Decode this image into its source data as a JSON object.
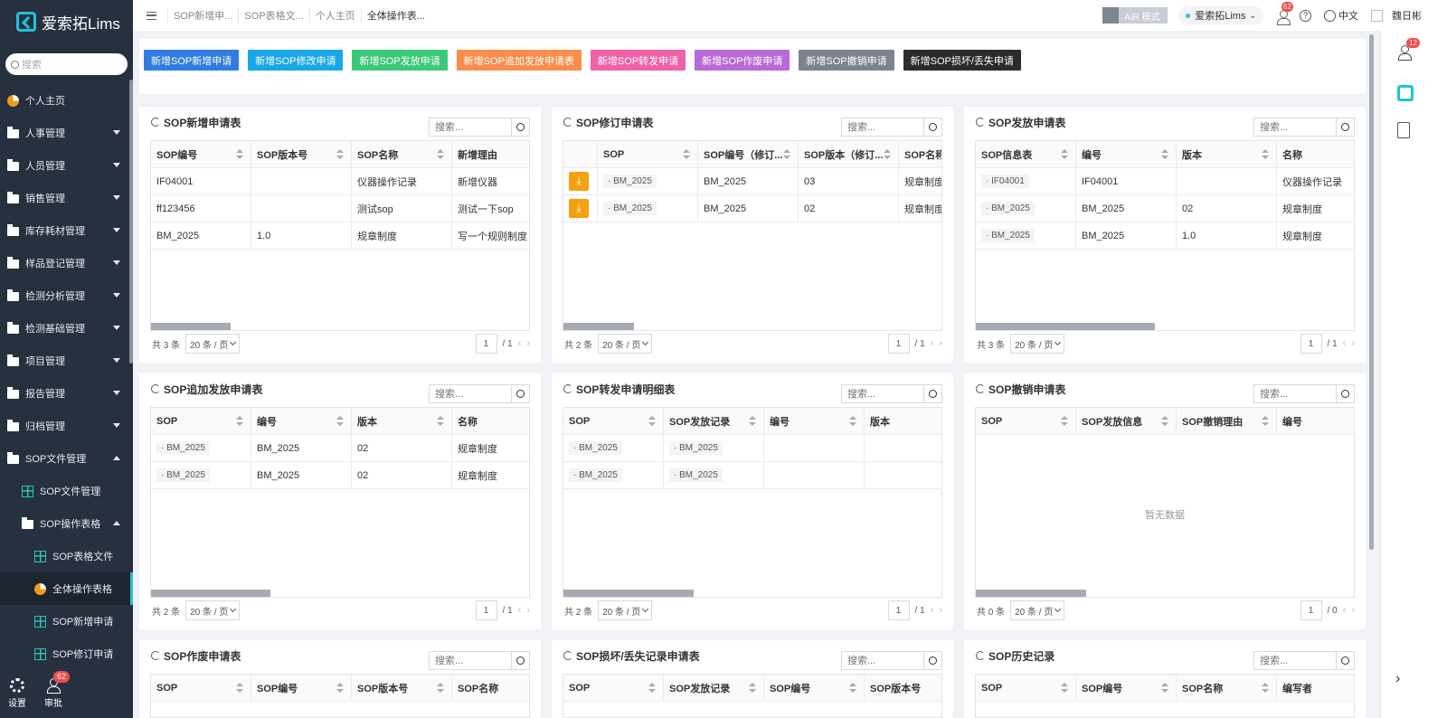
{
  "app": {
    "logo_text": "爱索拓Lims",
    "search_placeholder": "搜索"
  },
  "sidebar": {
    "items": [
      {
        "label": "个人主页",
        "icon": "pie-chart-icon"
      },
      {
        "label": "人事管理",
        "icon": "folder-icon"
      },
      {
        "label": "人员管理",
        "icon": "folder-icon"
      },
      {
        "label": "销售管理",
        "icon": "folder-icon"
      },
      {
        "label": "库存耗材管理",
        "icon": "folder-icon"
      },
      {
        "label": "样品登记管理",
        "icon": "folder-icon"
      },
      {
        "label": "检测分析管理",
        "icon": "folder-icon"
      },
      {
        "label": "检测基础管理",
        "icon": "folder-icon"
      },
      {
        "label": "项目管理",
        "icon": "folder-icon"
      },
      {
        "label": "报告管理",
        "icon": "folder-icon"
      },
      {
        "label": "归档管理",
        "icon": "folder-icon"
      },
      {
        "label": "SOP文件管理",
        "icon": "folder-icon"
      },
      {
        "label": "SOP文件管理",
        "icon": "table-icon"
      },
      {
        "label": "SOP操作表格",
        "icon": "folder-icon"
      },
      {
        "label": "SOP表格文件",
        "icon": "table-icon"
      },
      {
        "label": "全体操作表格",
        "icon": "pie-chart-icon"
      },
      {
        "label": "SOP新增申请",
        "icon": "table-icon"
      },
      {
        "label": "SOP修订申请",
        "icon": "table-icon"
      }
    ],
    "bottom": {
      "settings": "设置",
      "approve": "审批",
      "approve_badge": "62"
    }
  },
  "topbar": {
    "tabs": [
      "SOP新增申...",
      "SOP表格文...",
      "个人主页",
      "全体操作表..."
    ],
    "air_mode": "AIR 模式",
    "env": "爱索拓Lims",
    "msg_badge": "62",
    "help": "?",
    "lang": "中文",
    "user": "魏日彬"
  },
  "rail": {
    "badge": "12",
    "expand": "›"
  },
  "actions": [
    {
      "label": "新增SOP新增申请",
      "color": "#2f7de1"
    },
    {
      "label": "新增SOP修改申请",
      "color": "#19a7e8"
    },
    {
      "label": "新增SOP发放申请",
      "color": "#3cc879"
    },
    {
      "label": "新增SOP追加发放申请表",
      "color": "#f98d4c"
    },
    {
      "label": "新增SOP转发申请",
      "color": "#ef62a8"
    },
    {
      "label": "新增SOP作废申请",
      "color": "#b86ad6"
    },
    {
      "label": "新增SOP撤销申请",
      "color": "#7c838d"
    },
    {
      "label": "新增SOP损坏/丢失申请",
      "color": "#2b2b2b"
    }
  ],
  "common": {
    "search_placeholder": "搜索...",
    "page_size": "20 条 / 页",
    "empty": "暂无数据"
  },
  "cards": [
    {
      "title": "SOP新增申请表",
      "columns": [
        "SOP编号",
        "SOP版本号",
        "SOP名称",
        "新增理由"
      ],
      "rows": [
        [
          "IF04001",
          "",
          "仪器操作记录",
          "新增仪器"
        ],
        [
          "ff123456",
          "",
          "测试sop",
          "测试一下sop"
        ],
        [
          "BM_2025",
          "1.0",
          "规章制度",
          "写一个规则制度"
        ]
      ],
      "total": "共 3 条",
      "page": "1",
      "pages": "/ 1"
    },
    {
      "title": "SOP修订申请表",
      "columns": [
        "",
        "SOP",
        "SOP编号（修订...",
        "SOP版本（修订...",
        "SOP名称（"
      ],
      "rows": [
        [
          "",
          "BM_2025",
          "BM_2025",
          "03",
          "规章制度"
        ],
        [
          "",
          "BM_2025",
          "BM_2025",
          "02",
          "规章制度"
        ]
      ],
      "total": "共 2 条",
      "page": "1",
      "pages": "/ 1"
    },
    {
      "title": "SOP发放申请表",
      "columns": [
        "SOP信息表",
        "编号",
        "版本",
        "名称"
      ],
      "rows": [
        [
          "IF04001",
          "IF04001",
          "",
          "仪器操作记录"
        ],
        [
          "BM_2025",
          "BM_2025",
          "02",
          "规章制度"
        ],
        [
          "BM_2025",
          "BM_2025",
          "1.0",
          "规章制度"
        ]
      ],
      "total": "共 3 条",
      "page": "1",
      "pages": "/ 1"
    },
    {
      "title": "SOP追加发放申请表",
      "columns": [
        "SOP",
        "编号",
        "版本",
        "名称"
      ],
      "rows": [
        [
          "BM_2025",
          "BM_2025",
          "02",
          "规章制度"
        ],
        [
          "BM_2025",
          "BM_2025",
          "02",
          "规章制度"
        ]
      ],
      "total": "共 2 条",
      "page": "1",
      "pages": "/ 1"
    },
    {
      "title": "SOP转发申请明细表",
      "columns": [
        "SOP",
        "SOP发放记录",
        "编号",
        "版本"
      ],
      "rows": [
        [
          "BM_2025",
          "BM_2025",
          "",
          ""
        ],
        [
          "BM_2025",
          "BM_2025",
          "",
          ""
        ]
      ],
      "total": "共 2 条",
      "page": "1",
      "pages": "/ 1"
    },
    {
      "title": "SOP撤销申请表",
      "columns": [
        "SOP",
        "SOP发放信息",
        "SOP撤销理由",
        "编号"
      ],
      "rows": [],
      "total": "共 0 条",
      "page": "1",
      "pages": "/ 0"
    },
    {
      "title": "SOP作废申请表",
      "columns": [
        "SOP",
        "SOP编号",
        "SOP版本号",
        "SOP名称"
      ],
      "rows": []
    },
    {
      "title": "SOP损坏/丢失记录申请表",
      "columns": [
        "SOP",
        "SOP发放记录",
        "SOP编号",
        "SOP版本号"
      ],
      "rows": []
    },
    {
      "title": "SOP历史记录",
      "columns": [
        "SOP",
        "SOP编号",
        "SOP名称",
        "编写者"
      ],
      "rows": []
    }
  ]
}
